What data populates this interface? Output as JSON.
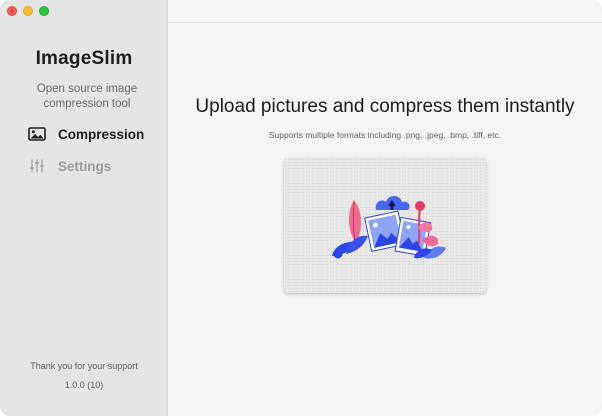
{
  "window": {
    "controls": [
      "close",
      "minimize",
      "zoom"
    ]
  },
  "sidebar": {
    "app_name": "ImageSlim",
    "tagline": "Open source image compression tool",
    "items": [
      {
        "label": "Compression",
        "icon": "image-icon",
        "active": true
      },
      {
        "label": "Settings",
        "icon": "sliders-icon",
        "active": false
      }
    ],
    "footer": {
      "thanks": "Thank you for your support",
      "version": "1.0.0 (10)"
    }
  },
  "main": {
    "headline": "Upload pictures and compress them instantly",
    "subline": "Supports multiple formats including .png, .jpeg, .bmp, .tiff, etc.",
    "dropzone": {
      "illustration": "upload-photos-illustration"
    }
  },
  "colors": {
    "accent_blue": "#2f44e6",
    "accent_pink": "#e8386a",
    "light_blue": "#6c8cf0"
  }
}
